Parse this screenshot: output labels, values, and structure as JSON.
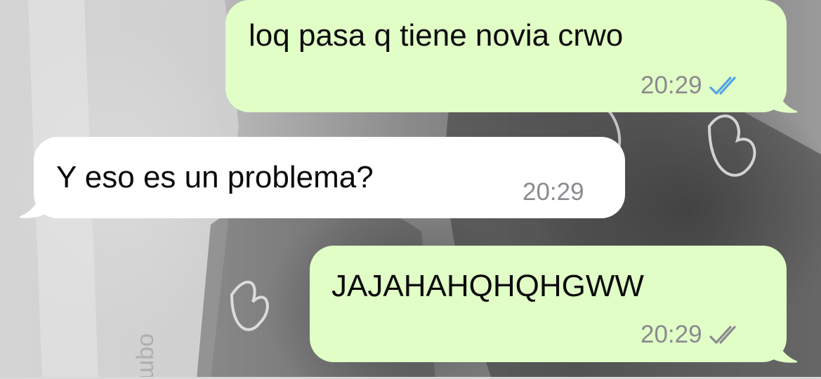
{
  "messages": [
    {
      "direction": "outgoing",
      "text": "loq pasa q tiene novia crwo",
      "time": "20:29",
      "status": "read"
    },
    {
      "direction": "incoming",
      "text": "Y eso es un problema?",
      "time": "20:29"
    },
    {
      "direction": "outgoing",
      "text": "JAJAHAHQHQHGWW",
      "time": "20:29",
      "status": "delivered"
    }
  ],
  "colors": {
    "outgoing_bubble": "#e1fec6",
    "incoming_bubble": "#ffffff",
    "read_ticks": "#4fa3e6",
    "delivered_ticks": "#8a8a8f",
    "timestamp": "#8a8a8f"
  }
}
